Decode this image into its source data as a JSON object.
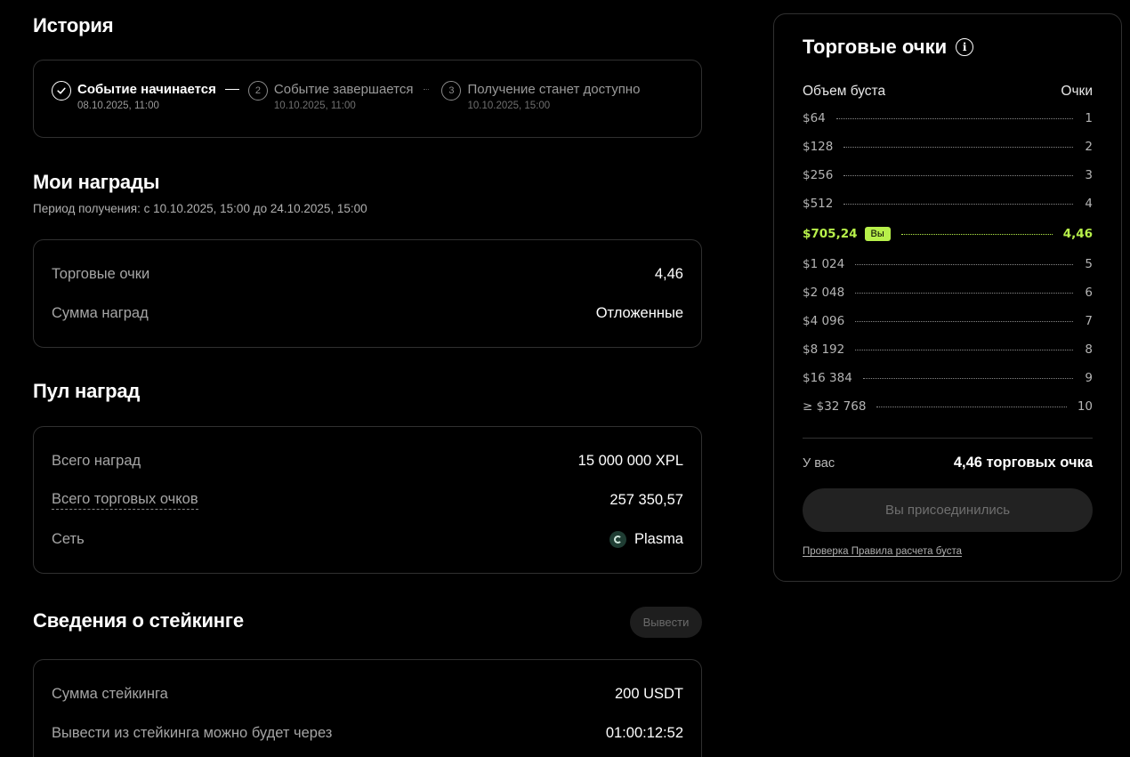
{
  "history": {
    "title": "История",
    "steps": [
      {
        "num": "1",
        "label": "Событие начинается",
        "date": "08.10.2025, 11:00"
      },
      {
        "num": "2",
        "label": "Событие завершается",
        "date": "10.10.2025, 11:00"
      },
      {
        "num": "3",
        "label": "Получение станет доступно",
        "date": "10.10.2025, 15:00"
      }
    ]
  },
  "my_rewards": {
    "title": "Мои награды",
    "period": "Период получения: с 10.10.2025, 15:00 до 24.10.2025, 15:00",
    "rows": [
      {
        "label": "Торговые очки",
        "value": "4,46"
      },
      {
        "label": "Сумма наград",
        "value": "Отложенные"
      }
    ]
  },
  "pool": {
    "title": "Пул наград",
    "rows": [
      {
        "label": "Всего наград",
        "value": "15 000 000 XPL"
      },
      {
        "label": "Всего торговых очков",
        "value": "257 350,57"
      },
      {
        "label": "Сеть",
        "value": "Plasma"
      }
    ]
  },
  "staking": {
    "title": "Сведения о стейкинге",
    "withdraw_label": "Вывести",
    "rows": [
      {
        "label": "Сумма стейкинга",
        "value": "200 USDT"
      },
      {
        "label": "Вывести из стейкинга можно будет через",
        "value": "01:00:12:52"
      }
    ]
  },
  "panel": {
    "title": "Торговые очки",
    "col_volume": "Объем буста",
    "col_points": "Очки",
    "tiers": [
      {
        "volume": "$64",
        "points": "1"
      },
      {
        "volume": "$128",
        "points": "2"
      },
      {
        "volume": "$256",
        "points": "3"
      },
      {
        "volume": "$512",
        "points": "4"
      },
      {
        "volume": "$705,24",
        "points": "4,46",
        "badge": "Вы"
      },
      {
        "volume": "$1 024",
        "points": "5"
      },
      {
        "volume": "$2 048",
        "points": "6"
      },
      {
        "volume": "$4 096",
        "points": "7"
      },
      {
        "volume": "$8 192",
        "points": "8"
      },
      {
        "volume": "$16 384",
        "points": "9"
      },
      {
        "volume": "≥ $32 768",
        "points": "10"
      }
    ],
    "you_label": "У вас",
    "you_value": "4,46 торговых очка",
    "joined_label": "Вы присоединились",
    "rules_link": "Проверка Правила расчета буста"
  },
  "colors": {
    "accent": "#b7f04a",
    "background": "#000000",
    "border": "#303030"
  },
  "icons": {
    "step_done": "check-circle-icon",
    "info": "info-icon",
    "network": "plasma-icon"
  }
}
